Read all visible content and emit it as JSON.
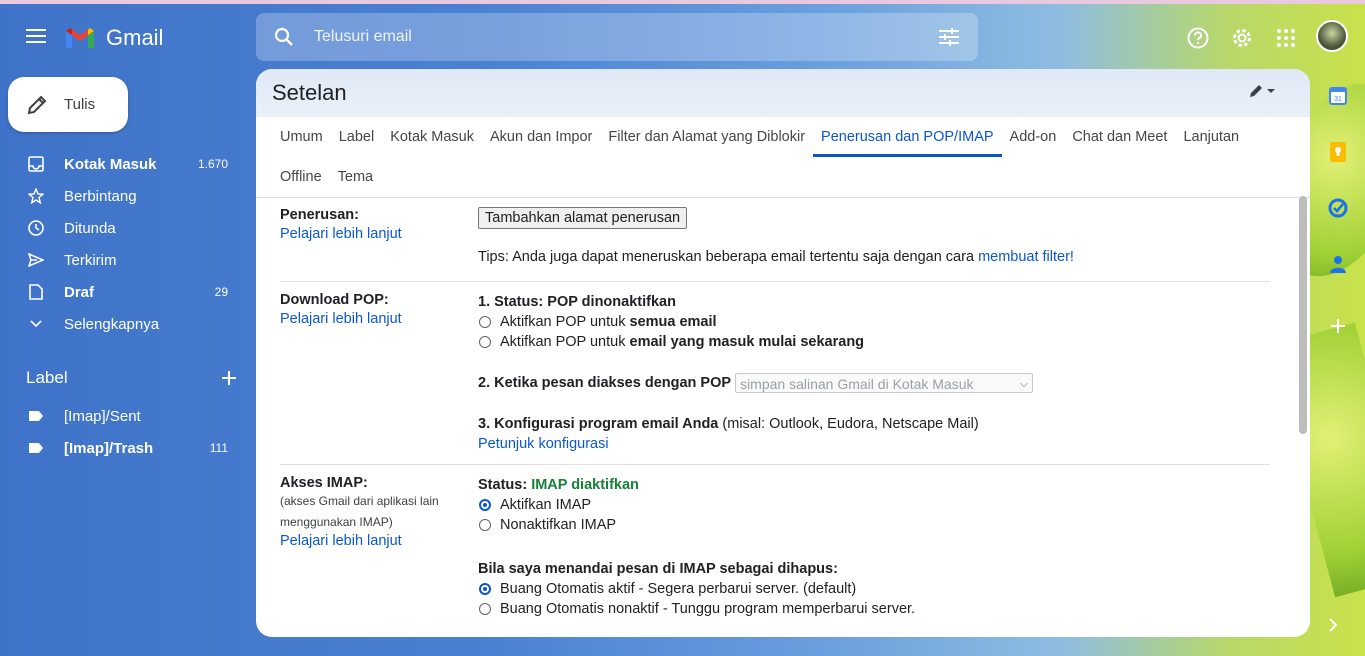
{
  "app": {
    "name": "Gmail"
  },
  "search": {
    "placeholder": "Telusuri email"
  },
  "compose": {
    "label": "Tulis"
  },
  "nav": [
    {
      "name": "nav-inbox",
      "icon": "inbox-icon",
      "label": "Kotak Masuk",
      "count": "1.670",
      "bold": true
    },
    {
      "name": "nav-starred",
      "icon": "star-icon",
      "label": "Berbintang",
      "count": ""
    },
    {
      "name": "nav-snoozed",
      "icon": "clock-icon",
      "label": "Ditunda",
      "count": ""
    },
    {
      "name": "nav-sent",
      "icon": "send-icon",
      "label": "Terkirim",
      "count": ""
    },
    {
      "name": "nav-drafts",
      "icon": "draft-icon",
      "label": "Draf",
      "count": "29",
      "bold": true
    },
    {
      "name": "nav-more",
      "icon": "chevron-down-icon",
      "label": "Selengkapnya",
      "count": ""
    }
  ],
  "labels": {
    "title": "Label",
    "items": [
      {
        "label": "[Imap]/Sent",
        "count": ""
      },
      {
        "label": "[Imap]/Trash",
        "count": "111",
        "bold": true
      }
    ]
  },
  "settings": {
    "title": "Setelan",
    "tabs": [
      "Umum",
      "Label",
      "Kotak Masuk",
      "Akun dan Impor",
      "Filter dan Alamat yang Diblokir",
      "Penerusan dan POP/IMAP",
      "Add-on",
      "Chat dan Meet",
      "Lanjutan",
      "Offline",
      "Tema"
    ],
    "active_tab": "Penerusan dan POP/IMAP",
    "forwarding": {
      "title": "Penerusan:",
      "learn_more": "Pelajari lebih lanjut",
      "add_button": "Tambahkan alamat penerusan",
      "tip": "Tips: Anda juga dapat meneruskan beberapa email tertentu saja dengan cara",
      "tip_link": "membuat filter!"
    },
    "pop": {
      "title": "Download POP:",
      "learn_more": "Pelajari lebih lanjut",
      "status": "1. Status: POP dinonaktifkan",
      "option1_prefix": "Aktifkan POP untuk",
      "option1_bold": "semua email",
      "option2_prefix": "Aktifkan POP untuk",
      "option2_bold": "email yang masuk mulai sekarang",
      "access_label": "2. Ketika pesan diakses dengan POP",
      "access_select": "simpan salinan Gmail di Kotak Masuk",
      "config_label": "3. Konfigurasi program email Anda",
      "config_hint": "(misal: Outlook, Eudora, Netscape Mail)",
      "config_link": "Petunjuk konfigurasi"
    },
    "imap": {
      "title": "Akses IMAP:",
      "subtitle": "(akses Gmail dari aplikasi lain menggunakan IMAP)",
      "learn_more": "Pelajari lebih lanjut",
      "status_label": "Status:",
      "status_value": "IMAP diaktifkan",
      "enable": "Aktifkan IMAP",
      "disable": "Nonaktifkan IMAP",
      "delete_heading": "Bila saya menandai pesan di IMAP sebagai dihapus:",
      "expunge_on": "Buang Otomatis aktif - Segera perbarui server. (default)",
      "expunge_off": "Buang Otomatis nonaktif - Tunggu program memperbarui server."
    }
  },
  "colors": {
    "accent": "#0b57d0",
    "status_green": "#188038"
  }
}
